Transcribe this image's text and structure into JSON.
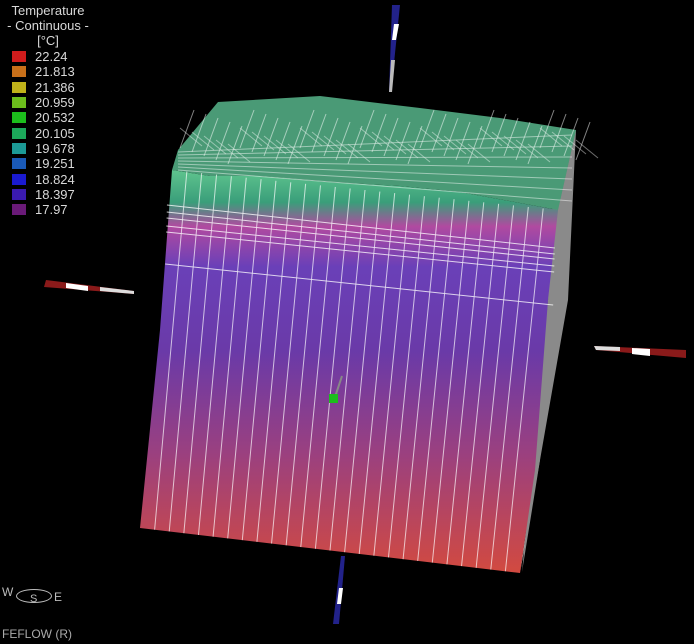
{
  "legend": {
    "title": "Temperature",
    "subtitle": "- Continuous -",
    "unit": "[°C]",
    "items": [
      {
        "value": "22.24",
        "color": "#d01c1c"
      },
      {
        "value": "21.813",
        "color": "#c8701a"
      },
      {
        "value": "21.386",
        "color": "#c0b21a"
      },
      {
        "value": "20.959",
        "color": "#6cbe1c"
      },
      {
        "value": "20.532",
        "color": "#1cbe1c"
      },
      {
        "value": "20.105",
        "color": "#1ca85a"
      },
      {
        "value": "19.678",
        "color": "#1c9a96"
      },
      {
        "value": "19.251",
        "color": "#1a5ab8"
      },
      {
        "value": "18.824",
        "color": "#1a1ad0"
      },
      {
        "value": "18.397",
        "color": "#3a1ab0"
      },
      {
        "value": "17.97",
        "color": "#6a1a78"
      }
    ]
  },
  "compass": {
    "west": "W",
    "east": "E",
    "south": "S"
  },
  "footer": {
    "brand": "FEFLOW (R)"
  },
  "model": {
    "top_color": "#4fb88a",
    "upper_color": "#6a44b8",
    "bottom_color": "#c84a40",
    "side_color": "#9a9a9a",
    "mesh_color": "#ffffff"
  }
}
